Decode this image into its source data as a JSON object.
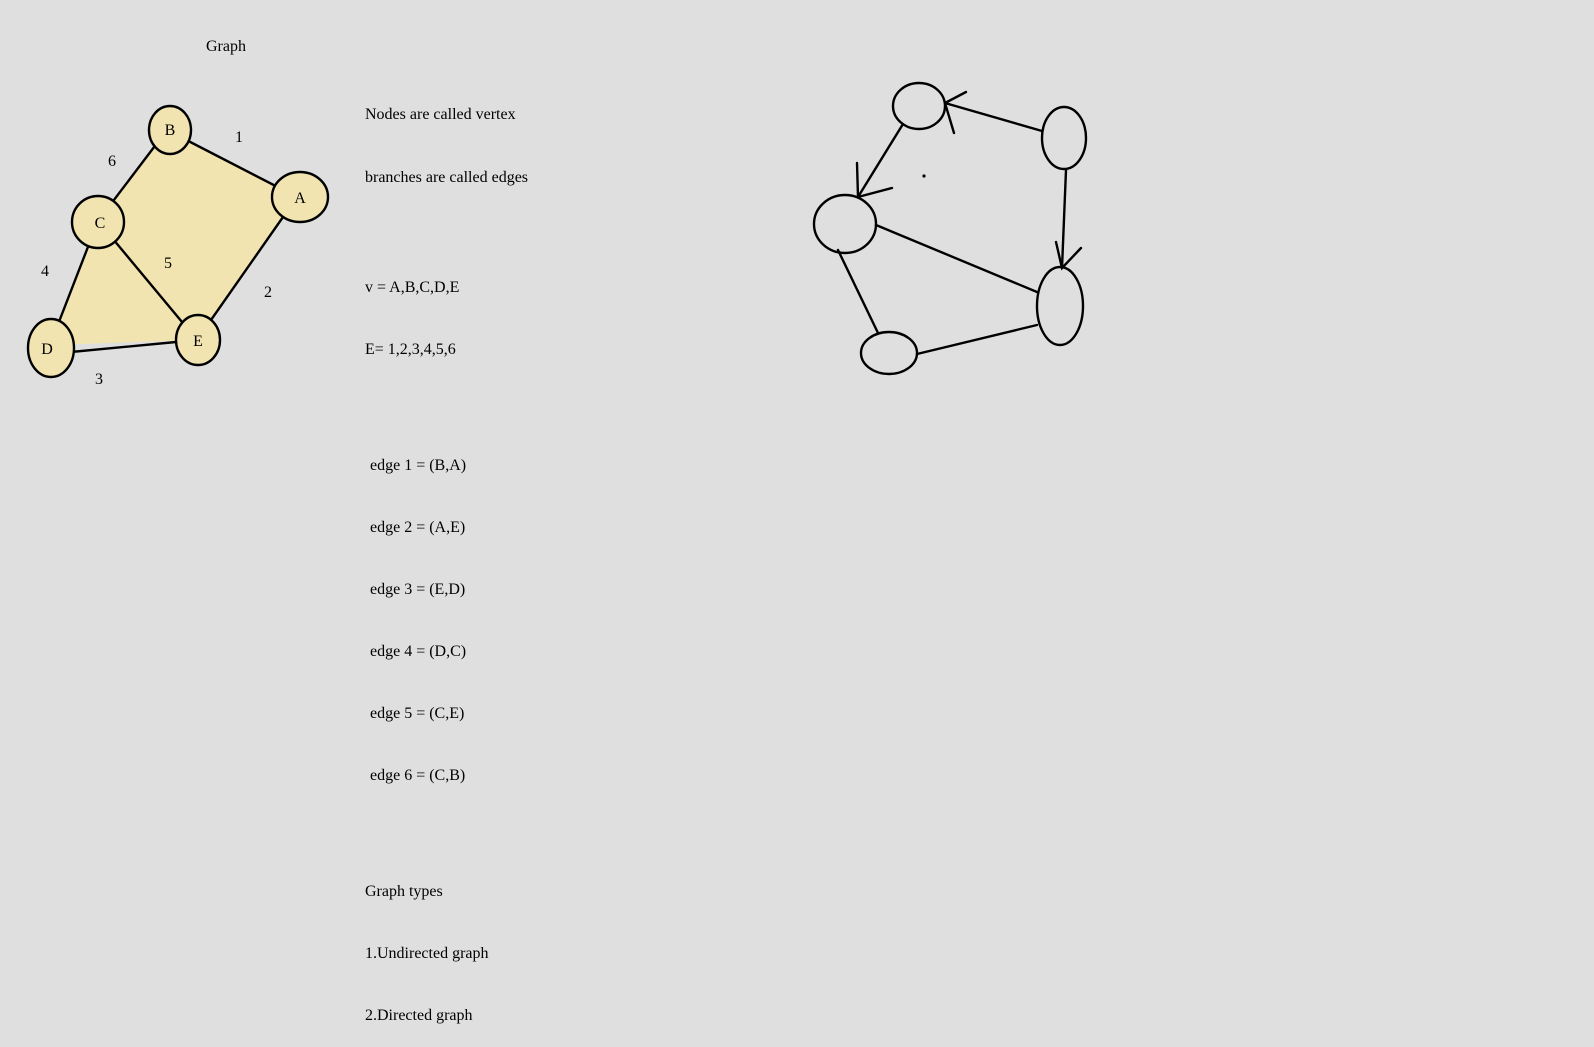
{
  "title": "Graph",
  "notes": {
    "line1": "Nodes are called vertex",
    "line2": "branches are called edges",
    "vertices": "v = A,B,C,D,E",
    "edges": "E= 1,2,3,4,5,6",
    "edge_list": [
      "edge 1 = (B,A)",
      "edge 2 = (A,E)",
      "edge 3 = (E,D)",
      "edge 4 = (D,C)",
      "edge 5 = (C,E)",
      "edge 6 = (C,B)"
    ],
    "types_heading": "Graph types",
    "types": [
      "1.Undirected graph",
      "2.Directed graph"
    ]
  },
  "undirected_graph": {
    "node_fill": "#f1e4b0",
    "region_fill": "#f1e4b0",
    "nodes": [
      "A",
      "B",
      "C",
      "D",
      "E"
    ],
    "edge_labels": [
      "1",
      "2",
      "3",
      "4",
      "5",
      "6"
    ]
  },
  "directed_graph": {
    "stroke_color": "#000000"
  }
}
